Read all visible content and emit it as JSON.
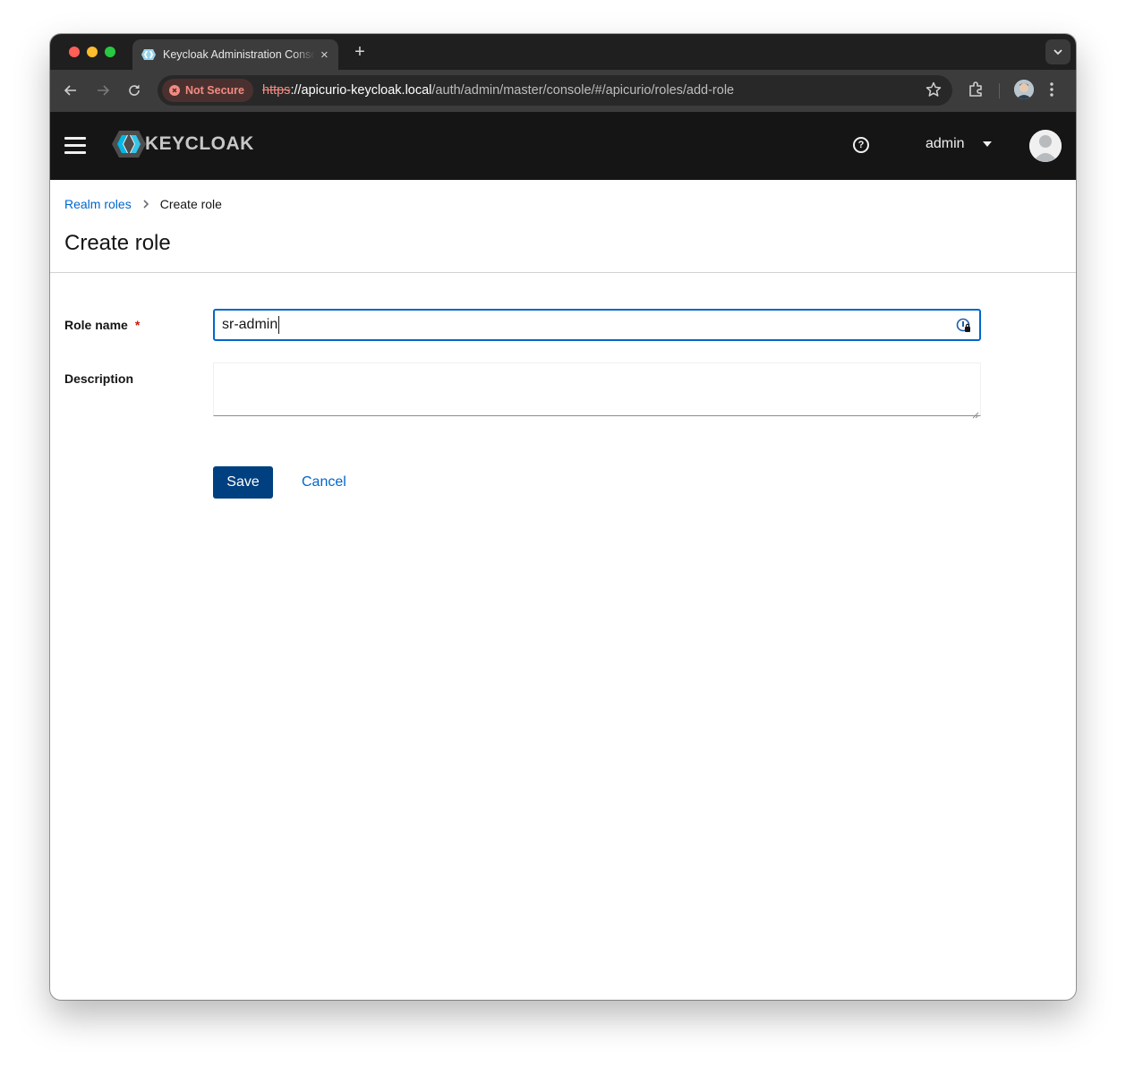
{
  "browser": {
    "tab_title": "Keycloak Administration Console",
    "tab_close": "×",
    "new_tab": "+",
    "security_label": "Not Secure",
    "url_scheme": "https",
    "url_host_prefix": "://apicurio-keycloak.local",
    "url_path": "/auth/admin/master/console/#/apicurio/roles/add-role"
  },
  "masthead": {
    "logo_text": "KEYCLOAK",
    "help_glyph": "?",
    "username": "admin"
  },
  "breadcrumb": {
    "parent": "Realm roles",
    "current": "Create role"
  },
  "page": {
    "title": "Create role"
  },
  "form": {
    "role_name_label": "Role name",
    "required_marker": "*",
    "role_name_value": "sr-admin",
    "description_label": "Description",
    "description_value": "",
    "save_label": "Save",
    "cancel_label": "Cancel"
  },
  "colors": {
    "link": "#0066cc",
    "primary_button": "#004080",
    "required": "#c9190b",
    "masthead": "#151515",
    "not_secure": "#f28b82"
  }
}
